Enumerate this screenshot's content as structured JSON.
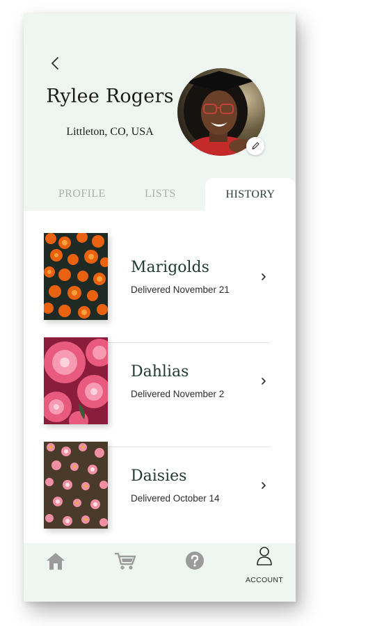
{
  "profile": {
    "name": "Rylee Rogers",
    "location": "Littleton, CO, USA"
  },
  "tabs": [
    {
      "label": "PROFILE",
      "active": false
    },
    {
      "label": "LISTS",
      "active": false
    },
    {
      "label": "HISTORY",
      "active": true
    }
  ],
  "history": [
    {
      "title": "Marigolds",
      "delivered": "Delivered November 21",
      "image": "marigold flowers photo"
    },
    {
      "title": "Dahlias",
      "delivered": "Delivered November 2",
      "image": "pink dahlia flowers photo"
    },
    {
      "title": "Daisies",
      "delivered": "Delivered October 14",
      "image": "pink daisy flowers photo"
    }
  ],
  "nav": {
    "home_icon": "home-icon",
    "cart_icon": "cart-icon",
    "help_icon": "question-icon",
    "account_label": "ACCOUNT"
  },
  "colors": {
    "background": "#eff6f1",
    "accent_text": "#1f3a2e",
    "inactive_tab": "#a9b0ad",
    "nav_icon": "#9b9b9b"
  }
}
